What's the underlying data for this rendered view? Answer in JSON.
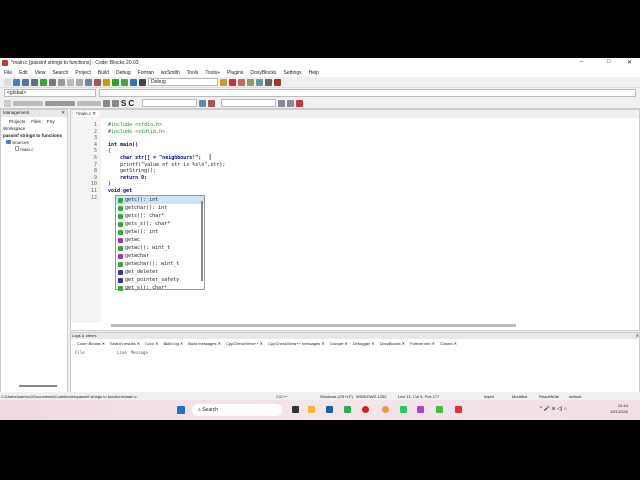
{
  "title": "*main.c [passinf strings to functions] - Code::Blocks 20.03",
  "menu": [
    "File",
    "Edit",
    "View",
    "Search",
    "Project",
    "Build",
    "Debug",
    "Fortran",
    "wxSmith",
    "Tools",
    "Tools+",
    "Plugins",
    "DoxyBlocks",
    "Settings",
    "Help"
  ],
  "toolbar": {
    "build_target": "Debug",
    "scope": "<global>"
  },
  "management": {
    "title": "Management",
    "tabs": [
      "Projects",
      "Files",
      "FSy"
    ],
    "workspace": "Workspace",
    "project": "passinf strings to functions",
    "folder": "Sources",
    "file": "main.c"
  },
  "editor": {
    "tab": "*main.c",
    "lines": [
      {
        "n": "1",
        "t": "#include <stdio.h>",
        "c": "pp"
      },
      {
        "n": "2",
        "t": "#include <stdlib.h>",
        "c": "pp"
      },
      {
        "n": "3",
        "t": "",
        "c": ""
      },
      {
        "n": "4",
        "t": "int main()",
        "c": ""
      },
      {
        "n": "5",
        "t": "{",
        "c": ""
      },
      {
        "n": "6",
        "t": "    char str[] = \"neighbours!\";",
        "c": ""
      },
      {
        "n": "7",
        "t": "    printf(\"value of str is %s\\n\",str);",
        "c": ""
      },
      {
        "n": "8",
        "t": "    getString();",
        "c": ""
      },
      {
        "n": "9",
        "t": "    return 0;",
        "c": ""
      },
      {
        "n": "10",
        "t": "}",
        "c": ""
      },
      {
        "n": "11",
        "t": "void get",
        "c": ""
      },
      {
        "n": "12",
        "t": "",
        "c": ""
      }
    ]
  },
  "autocomplete": [
    "getc(): int",
    "getchar(): int",
    "gets(): char*",
    "gets_s(): char*",
    "getw(): int",
    "getwc",
    "getwc(): wint_t",
    "getwchar",
    "getwchar(): wint_t",
    "get_deleter",
    "get_pointer_safety",
    "get_s(): char*"
  ],
  "logs": {
    "title": "Logs & others",
    "tabs": [
      "Code::Blocks",
      "Search results",
      "Cccc",
      "Build log",
      "Build messages",
      "CppCheck/Vera++",
      "CppCheck/Vera++ messages",
      "Cscope",
      "Debugger",
      "DoxyBlocks",
      "Fortran info",
      "Closed"
    ],
    "columns": [
      "File",
      "Line",
      "Message"
    ]
  },
  "status": {
    "path": "C:\\Users\\bambo1\\Documents\\Codeblocks\\passinf strings to functions\\main.c",
    "lang": "C/C++",
    "eol": "Windows (CR+LF)",
    "enc": "WINDOWS-1252",
    "pos": "Line 11, Col 9, Pos 177",
    "mode": "Insert",
    "mod": "Modified",
    "rw": "Read/Write",
    "prof": "default"
  },
  "taskbar": {
    "search": "Search",
    "time": "22:44",
    "date": "10/1/2026"
  }
}
